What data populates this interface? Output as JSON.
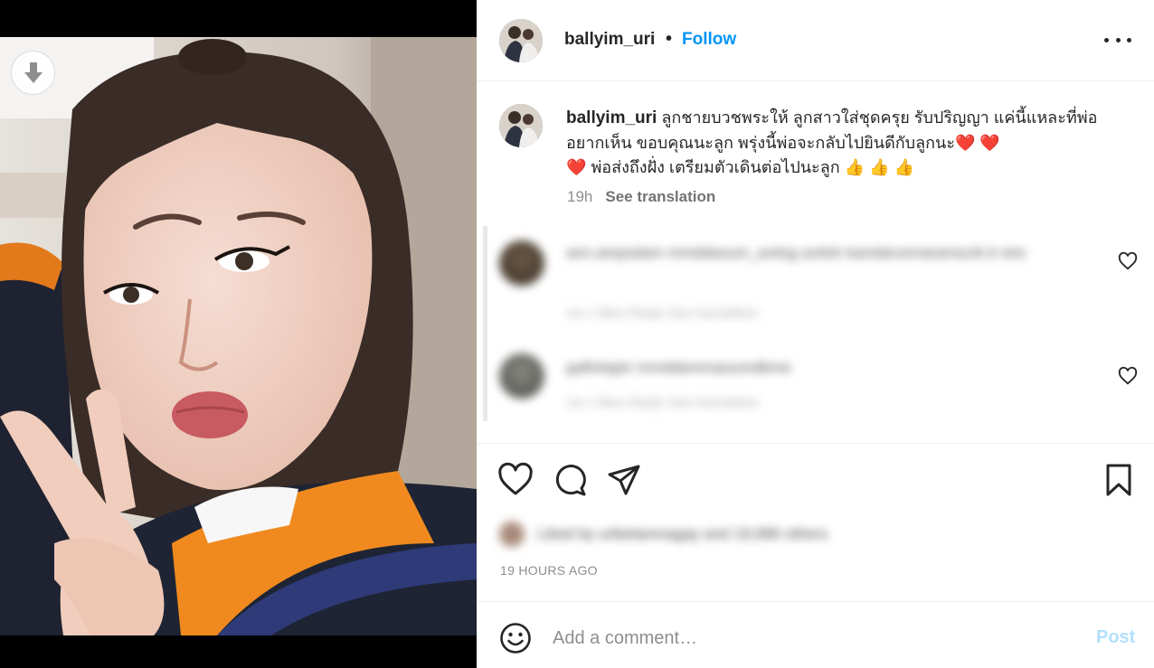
{
  "post": {
    "username": "ballyim_uri",
    "separator": "•",
    "follow_label": "Follow",
    "more_icon": "more-horizontal-icon"
  },
  "caption": {
    "username": "ballyim_uri",
    "text": "ลูกชายบวชพระให้ ลูกสาวใส่ชุดครุย รับปริญญา แค่นี้แหละที่พ่ออยากเห็น ขอบคุณนะลูก พรุ่งนี้พ่อจะกลับไปยินดีกับลูกนะ",
    "hearts": "❤️ ❤️",
    "heart_end": "❤️",
    "text2": "พ่อส่งถึงฝั่ง เตรียมตัวเดินต่อไปนะลูก",
    "thumbs": "👍 👍 👍",
    "time": "19h",
    "see_translation": "See translation"
  },
  "comments": [
    {
      "text": "ann.ampsdam mmddaoum_avitsg avitsh kamdecemaramscitr.it nire",
      "meta": "1w    1 likes    Reply    See translation"
    },
    {
      "text": "galfohpjm mmddammaoumdbme",
      "meta": "1w    1 likes    Reply    See translation"
    }
  ],
  "likes_text": "Liked by uribelamnagay and 19,990 others",
  "date": "19 HOURS AGO",
  "add_comment": {
    "placeholder": "Add a comment…",
    "post_label": "Post"
  },
  "colors": {
    "accent": "#0095f6",
    "post_disabled": "#b2dffc",
    "muted": "#8e8e8e"
  }
}
